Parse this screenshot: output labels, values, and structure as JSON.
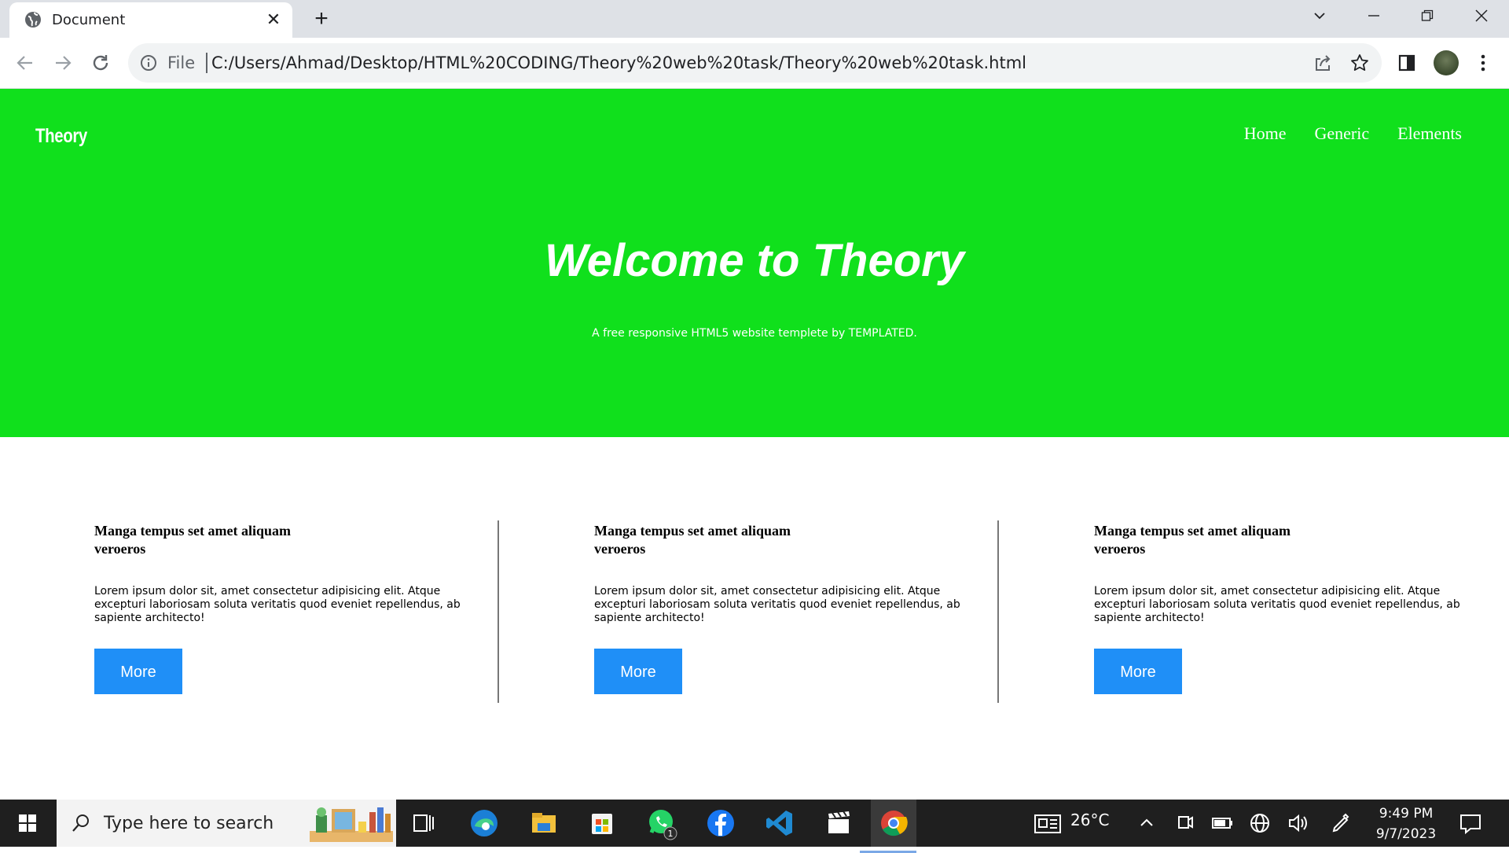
{
  "browser": {
    "tab_title": "Document",
    "address_prefix": "File",
    "url": "C:/Users/Ahmad/Desktop/HTML%20CODING/Theory%20web%20task/Theory%20web%20task.html"
  },
  "site": {
    "logo": "Theory",
    "nav": [
      "Home",
      "Generic",
      "Elements"
    ],
    "hero_title": "Welcome to Theory",
    "hero_subtitle": "A free responsive HTML5 website templete by TEMPLATED.",
    "accent_color": "#10e01c",
    "button_color": "#1f8ff7",
    "features": [
      {
        "title": "Manga tempus set amet aliquam veroeros",
        "body": "Lorem ipsum dolor sit, amet consectetur adipisicing elit. Atque excepturi laboriosam soluta veritatis quod eveniet repellendus, ab sapiente architecto!",
        "button": "More"
      },
      {
        "title": "Manga tempus set amet aliquam veroeros",
        "body": "Lorem ipsum dolor sit, amet consectetur adipisicing elit. Atque excepturi laboriosam soluta veritatis quod eveniet repellendus, ab sapiente architecto!",
        "button": "More"
      },
      {
        "title": "Manga tempus set amet aliquam veroeros",
        "body": "Lorem ipsum dolor sit, amet consectetur adipisicing elit. Atque excepturi laboriosam soluta veritatis quod eveniet repellendus, ab sapiente architecto!",
        "button": "More"
      }
    ]
  },
  "taskbar": {
    "search_placeholder": "Type here to search",
    "weather": "26°C",
    "time": "9:49 PM",
    "date": "9/7/2023",
    "whatsapp_badge": "1",
    "apps": [
      "task-view-icon",
      "edge-icon",
      "file-explorer-icon",
      "store-icon",
      "whatsapp-icon",
      "facebook-icon",
      "vscode-icon",
      "clapper-icon",
      "chrome-icon"
    ]
  }
}
